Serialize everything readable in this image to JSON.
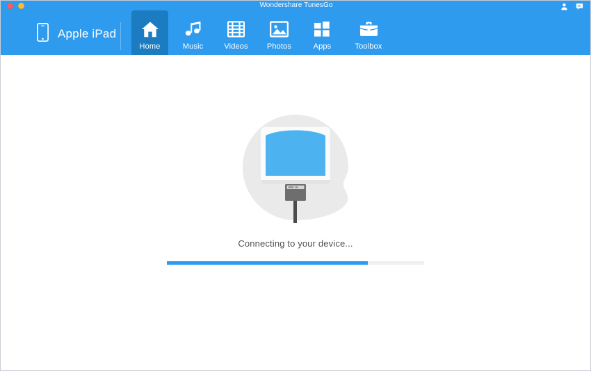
{
  "window": {
    "title": "Wondershare TunesGo",
    "controls": [
      {
        "name": "close",
        "color": "#fc5c57"
      },
      {
        "name": "minimize",
        "color": "#fdbc2f"
      }
    ],
    "title_actions": [
      {
        "name": "account-icon",
        "label": "Account"
      },
      {
        "name": "feedback-icon",
        "label": "Feedback"
      }
    ]
  },
  "header": {
    "device_icon": "mobile-device-icon",
    "device_name": "Apple iPad",
    "accent_color": "#2f9bee",
    "active_tab_color": "#1b7cc1"
  },
  "tabs": [
    {
      "id": "home",
      "label": "Home",
      "icon": "home-icon",
      "active": true
    },
    {
      "id": "music",
      "label": "Music",
      "icon": "music-icon",
      "active": false
    },
    {
      "id": "videos",
      "label": "Videos",
      "icon": "video-icon",
      "active": false
    },
    {
      "id": "photos",
      "label": "Photos",
      "icon": "photo-icon",
      "active": false
    },
    {
      "id": "apps",
      "label": "Apps",
      "icon": "apps-grid-icon",
      "active": false
    },
    {
      "id": "toolbox",
      "label": "Toolbox",
      "icon": "briefcase-icon",
      "active": false
    }
  ],
  "main": {
    "illustration": "device-connecting-illustration",
    "status_text": "Connecting to your device...",
    "progress": {
      "percent": 78,
      "fill_color": "#2b9bf4",
      "track_color": "#f0f0f0"
    }
  }
}
